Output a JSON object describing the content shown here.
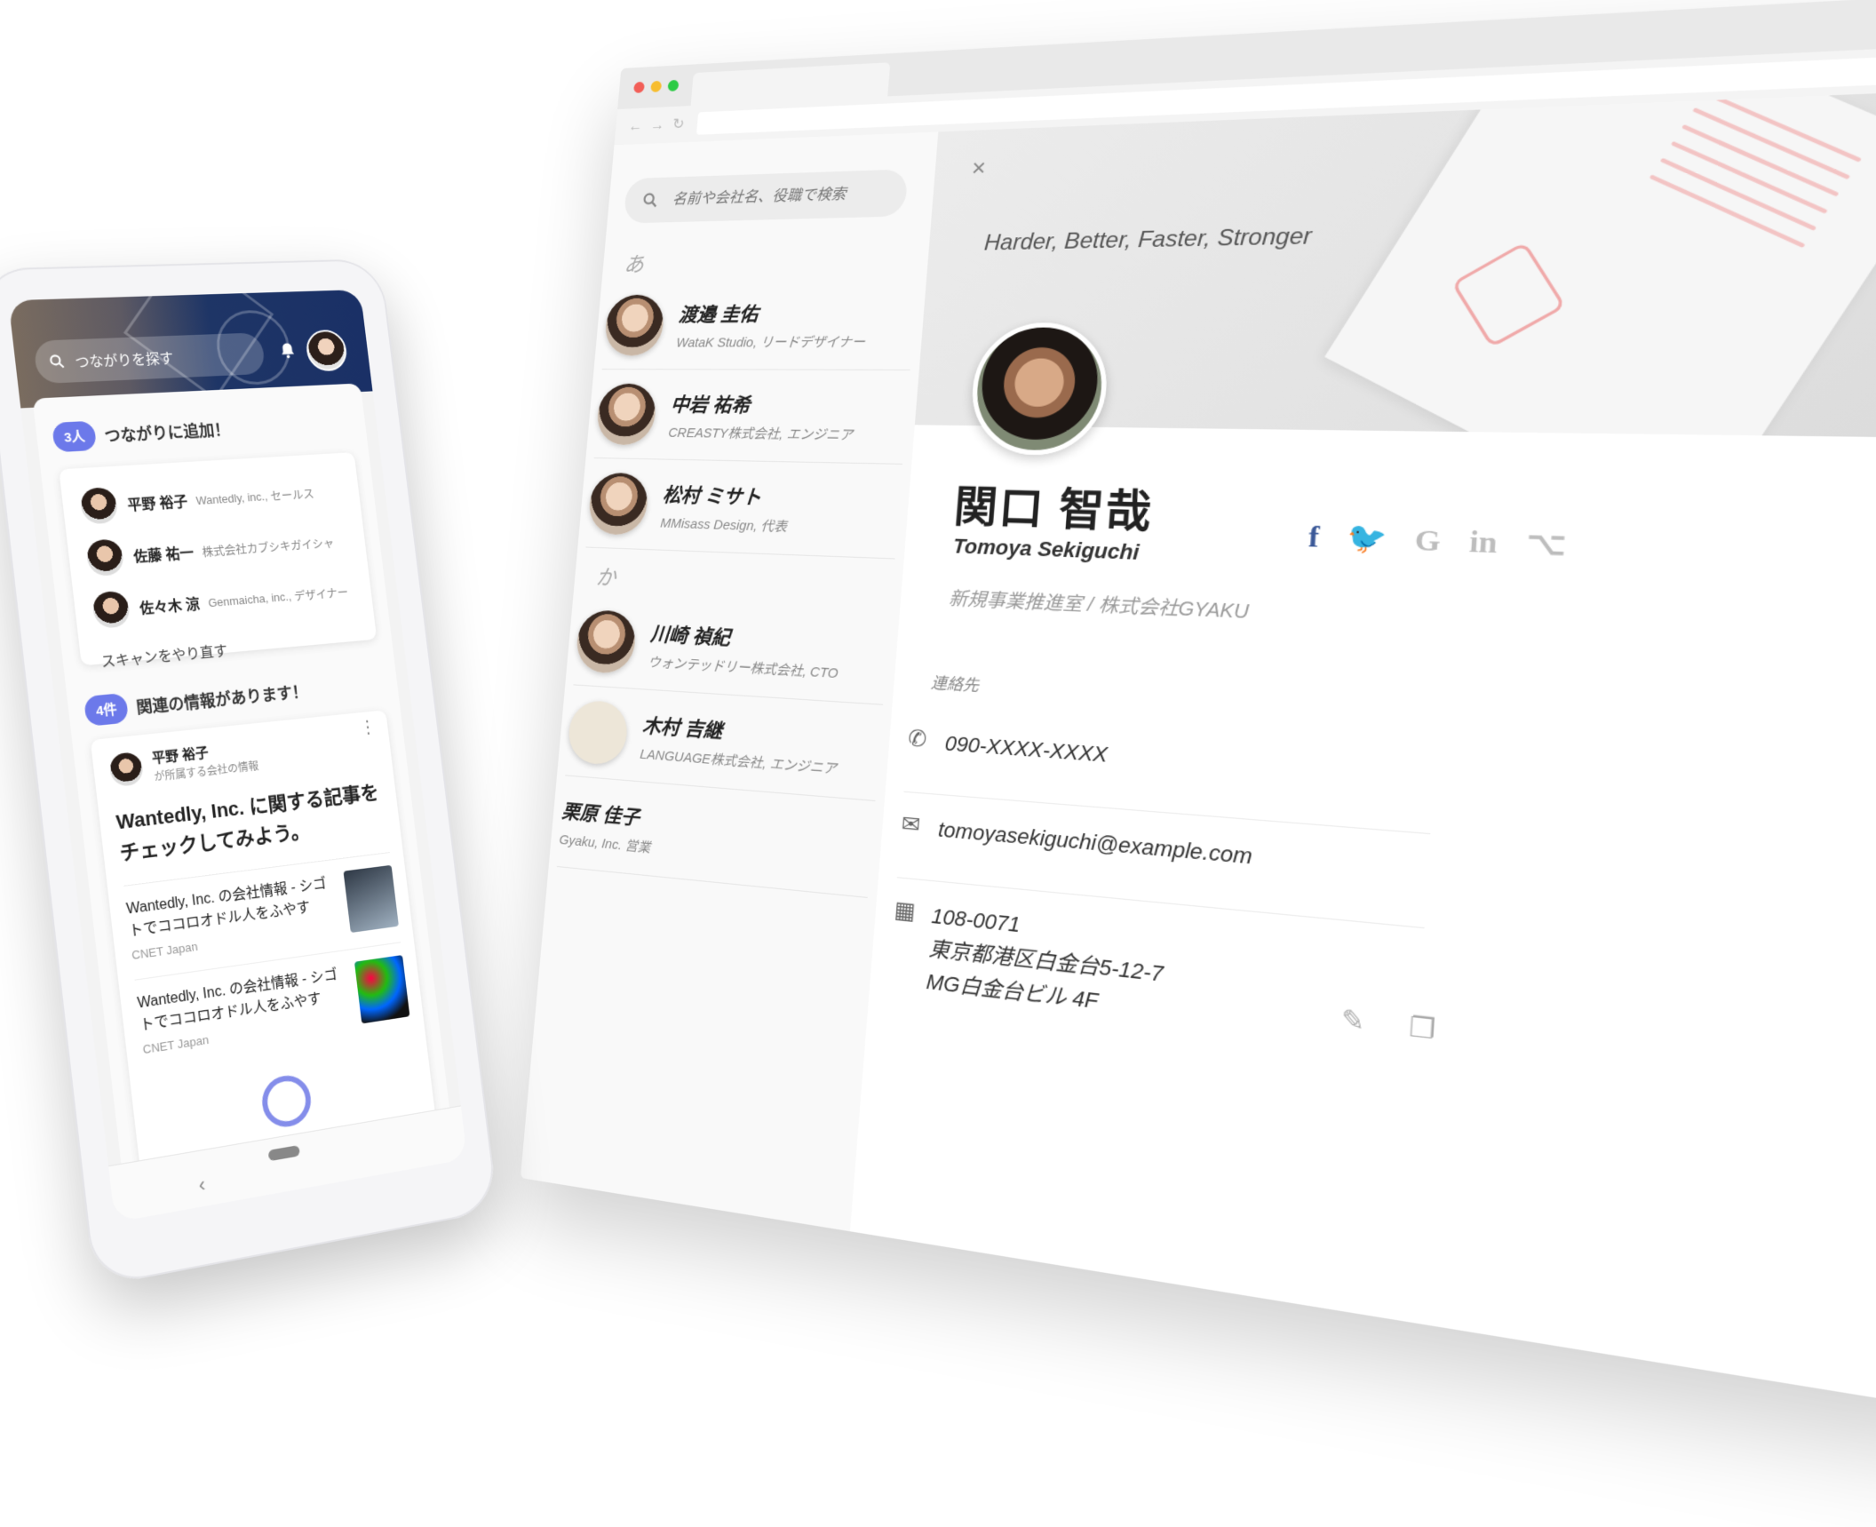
{
  "browser": {
    "search_placeholder": "名前や会社名、役職で検索",
    "sections": [
      {
        "heading": "あ",
        "contacts": [
          {
            "name": "渡邉 圭佑",
            "detail": "WataK Studio, リードデザイナー"
          },
          {
            "name": "中岩 祐希",
            "detail": "CREASTY株式会社, エンジニア"
          },
          {
            "name": "松村 ミサト",
            "detail": "MMisass Design, 代表"
          }
        ]
      },
      {
        "heading": "か",
        "contacts": [
          {
            "name": "川崎 禎紀",
            "detail": "ウォンテッドリー株式会社, CTO"
          },
          {
            "name": "木村 吉継",
            "detail": "LANGUAGE株式会社, エンジニア"
          },
          {
            "name": "栗原 佳子",
            "detail": "Gyaku, Inc. 営業"
          }
        ]
      }
    ],
    "profile": {
      "close_icon": "×",
      "tagline": "Harder, Better, Faster, Stronger",
      "name": "関口 智哉",
      "name_en": "Tomoya Sekiguchi",
      "title": "新規事業推進室 / 株式会社GYAKU",
      "socials": [
        {
          "label": "f",
          "color": "#3b5998",
          "icon": "facebook-icon"
        },
        {
          "label": "🐦",
          "color": "#1da1f2",
          "icon": "twitter-icon"
        },
        {
          "label": "G",
          "color": "#bdbdbd",
          "icon": "google-icon"
        },
        {
          "label": "in",
          "color": "#bdbdbd",
          "icon": "linkedin-icon"
        },
        {
          "label": "⌥",
          "color": "#bdbdbd",
          "icon": "github-icon"
        }
      ],
      "contact_label": "連絡先",
      "phone": "090-XXXX-XXXX",
      "email": "tomoyasekiguchi@example.com",
      "address_lines": [
        "108-0071",
        "東京都港区白金台5-12-7",
        "MG白金台ビル 4F"
      ]
    }
  },
  "phone": {
    "search_placeholder": "つながりを探す",
    "added": {
      "badge": "3人",
      "label": "つながりに追加！",
      "people": [
        {
          "name": "平野 裕子",
          "company": "Wantedly, inc., セールス"
        },
        {
          "name": "佐藤 祐一",
          "company": "株式会社カブシキガイシャ"
        },
        {
          "name": "佐々木 涼",
          "company": "Genmaicha, inc., デザイナー"
        }
      ],
      "rescan": "スキャンをやり直す"
    },
    "related": {
      "badge": "4件",
      "label": "関連の情報があります！",
      "person_name": "平野 裕子",
      "person_sub": "が所属する会社の情報",
      "headline": "Wantedly, Inc. に関する記事をチェックしてみよう。",
      "articles": [
        {
          "title": "Wantedly, Inc. の会社情報 - シゴトでココロオドル人をふやす",
          "source": "CNET Japan"
        },
        {
          "title": "Wantedly, Inc. の会社情報 - シゴトでココロオドル人をふやす",
          "source": "CNET Japan"
        }
      ]
    }
  }
}
